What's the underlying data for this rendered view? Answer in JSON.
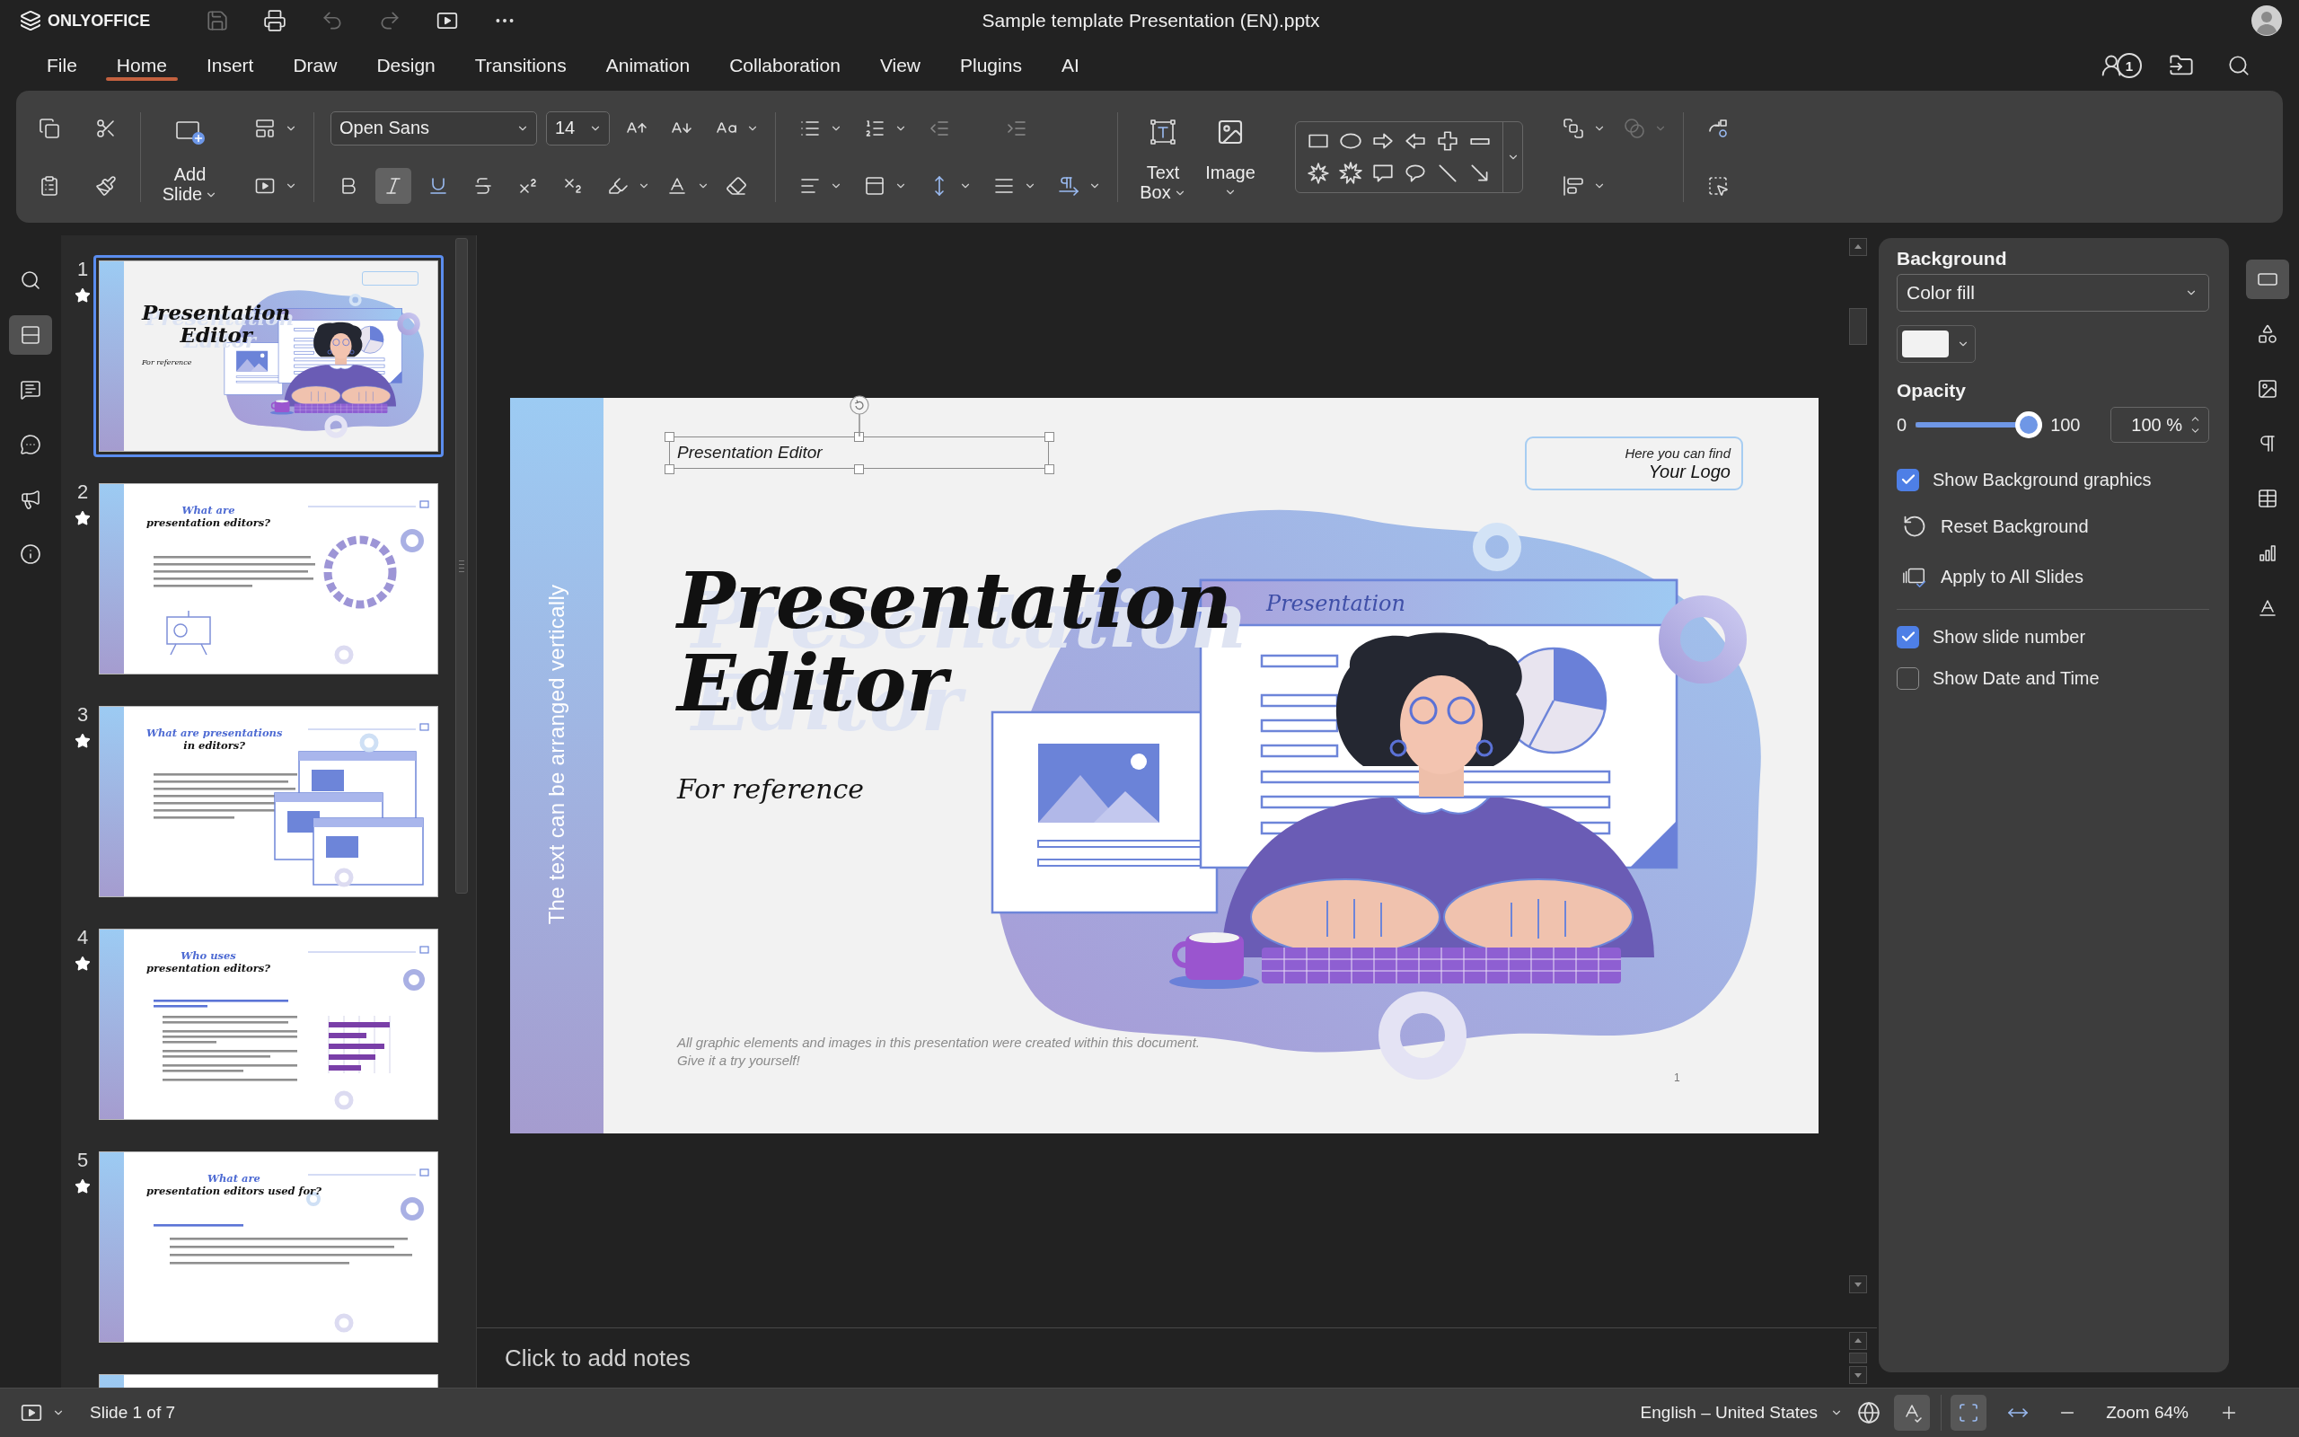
{
  "app": {
    "name": "ONLYOFFICE",
    "document_title": "Sample template Presentation (EN).pptx"
  },
  "quick_access": [
    {
      "kind": "save",
      "disabled": true
    },
    {
      "kind": "print",
      "disabled": false
    },
    {
      "kind": "undo",
      "disabled": true
    },
    {
      "kind": "redo",
      "disabled": true
    },
    {
      "kind": "slideshow",
      "disabled": false
    },
    {
      "kind": "more",
      "disabled": false
    }
  ],
  "menu_tabs": [
    {
      "label": "File",
      "selected": false
    },
    {
      "label": "Home",
      "selected": true
    },
    {
      "label": "Insert",
      "selected": false
    },
    {
      "label": "Draw",
      "selected": false
    },
    {
      "label": "Design",
      "selected": false
    },
    {
      "label": "Transitions",
      "selected": false
    },
    {
      "label": "Animation",
      "selected": false
    },
    {
      "label": "Collaboration",
      "selected": false
    },
    {
      "label": "View",
      "selected": false
    },
    {
      "label": "Plugins",
      "selected": false
    },
    {
      "label": "AI",
      "selected": false
    }
  ],
  "header_tools": {
    "users_count": "1"
  },
  "toolbar": {
    "add_slide": "Add Slide",
    "font_name": "Open Sans",
    "font_size": "14",
    "text_format": [
      {
        "kind": "bold",
        "on": false
      },
      {
        "kind": "italic",
        "on": true
      },
      {
        "kind": "underline",
        "on": false
      },
      {
        "kind": "strikethrough",
        "on": false
      },
      {
        "kind": "superscript",
        "on": false
      },
      {
        "kind": "subscript",
        "on": false
      }
    ],
    "text_box": "Text Box",
    "image": "Image",
    "group_disabled": true
  },
  "left_rail": [
    {
      "kind": "search",
      "selected": false
    },
    {
      "kind": "slides",
      "selected": true
    },
    {
      "kind": "comments",
      "selected": false
    },
    {
      "kind": "chat",
      "selected": false
    },
    {
      "kind": "feedback",
      "selected": false
    },
    {
      "kind": "about",
      "selected": false
    }
  ],
  "thumbnails": [
    {
      "number": "1",
      "kind": "title",
      "selected": true,
      "starred": true,
      "title": "Presentation Editor",
      "subtitle": "For reference"
    },
    {
      "number": "2",
      "kind": "definition",
      "selected": false,
      "starred": true,
      "title_accent": "What are",
      "title": "presentation editors?"
    },
    {
      "number": "3",
      "kind": "gallery",
      "selected": false,
      "starred": true,
      "title_accent": "What are presentations",
      "title": "in editors?"
    },
    {
      "number": "4",
      "kind": "chart",
      "selected": false,
      "starred": true,
      "title_accent": "Who uses",
      "title": "presentation editors?"
    },
    {
      "number": "5",
      "kind": "list",
      "selected": false,
      "starred": true,
      "title_accent": "What are",
      "title": "presentation editors used for?"
    }
  ],
  "slide": {
    "vertical_text": "The text can be arranged vertically",
    "header": {
      "text": "Presentation Editor",
      "selected": true
    },
    "logo_caption": "Here you can find",
    "logo_text": "Your Logo",
    "title": "Presentation Editor",
    "subtitle": "For reference",
    "illustration_label": "Presentation",
    "footnote": [
      "All graphic elements and images in this presentation were created within this document.",
      "Give it a try yourself!"
    ],
    "number": "1"
  },
  "notes": {
    "placeholder": "Click to add notes"
  },
  "settings_panel": {
    "title": "Background",
    "fill_type": "Color fill",
    "opacity_title": "Opacity",
    "opacity_min": "0",
    "opacity_max": "100",
    "opacity": {
      "level": 1
    },
    "opacity_value": "100 %",
    "show_background_graphics": {
      "label": "Show Background graphics",
      "checked": true
    },
    "reset_background": "Reset Background",
    "apply_to_all": "Apply to All Slides",
    "footer_options": [
      {
        "label": "Show slide number",
        "checked": true
      },
      {
        "label": "Show Date and Time",
        "checked": false
      }
    ]
  },
  "right_rail": [
    {
      "kind": "slide",
      "selected": true
    },
    {
      "kind": "shape",
      "selected": false
    },
    {
      "kind": "image",
      "selected": false
    },
    {
      "kind": "paragraph",
      "selected": false
    },
    {
      "kind": "table",
      "selected": false
    },
    {
      "kind": "chart",
      "selected": false
    },
    {
      "kind": "text_art",
      "selected": false
    }
  ],
  "status_bar": {
    "slide_counter": "Slide 1 of 7",
    "language": "English – United States",
    "spellcheck_on": true,
    "fit_slide_on": true,
    "fit_width_on": false,
    "zoom": "Zoom 64%"
  }
}
